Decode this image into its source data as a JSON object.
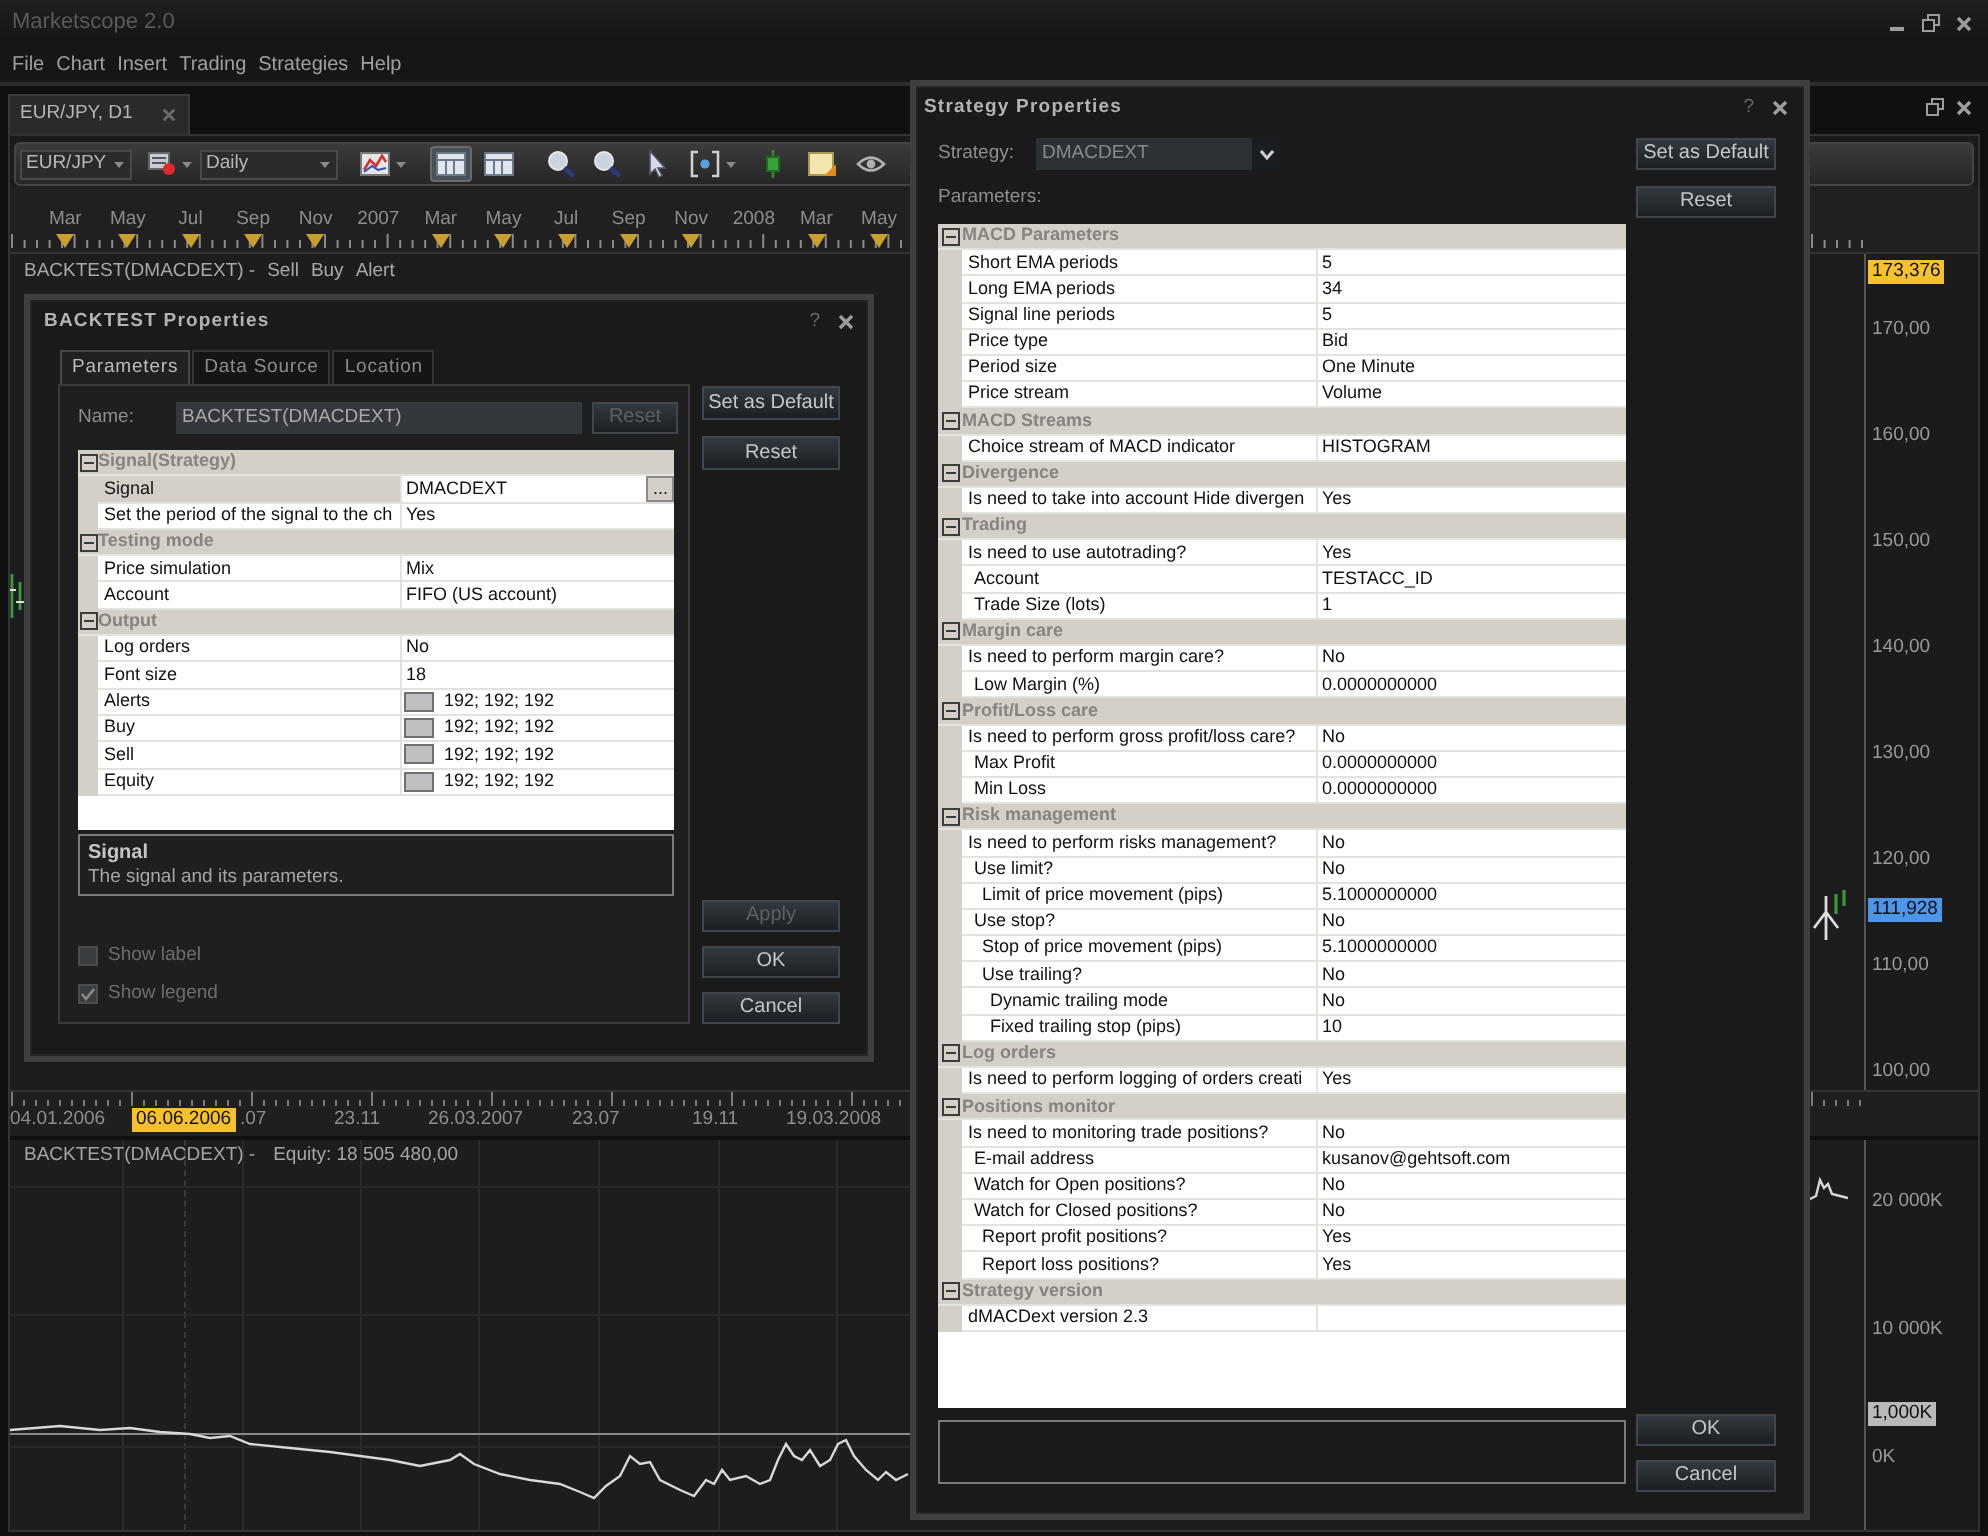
{
  "app": {
    "title": "Marketscope 2.0",
    "menu": [
      "File",
      "Chart",
      "Insert",
      "Trading",
      "Strategies",
      "Help"
    ]
  },
  "chart_window": {
    "tab": {
      "label": "EUR/JPY, D1"
    },
    "toolbar": {
      "instrument": "EUR/JPY",
      "period": "Daily",
      "tools": [
        {
          "kind": "line",
          "pressed": false
        },
        {
          "kind": "table",
          "pressed": true
        },
        {
          "kind": "table",
          "pressed": false
        },
        {
          "kind": "zoom",
          "pressed": false
        },
        {
          "kind": "zoom",
          "pressed": false
        },
        {
          "kind": "pointer",
          "pressed": false
        },
        {
          "kind": "target",
          "pressed": false
        },
        {
          "kind": "candle",
          "pressed": false
        },
        {
          "kind": "note",
          "pressed": false
        },
        {
          "kind": "eye",
          "pressed": false
        }
      ]
    },
    "timeline": [
      {
        "text": "Mar",
        "kind": "month"
      },
      {
        "text": "May",
        "kind": "month"
      },
      {
        "text": "Jul",
        "kind": "month"
      },
      {
        "text": "Sep",
        "kind": "month"
      },
      {
        "text": "Nov",
        "kind": "month"
      },
      {
        "text": "2007",
        "kind": "year"
      },
      {
        "text": "Mar",
        "kind": "month"
      },
      {
        "text": "May",
        "kind": "month"
      },
      {
        "text": "Jul",
        "kind": "month"
      },
      {
        "text": "Sep",
        "kind": "month"
      },
      {
        "text": "Nov",
        "kind": "month"
      },
      {
        "text": "2008",
        "kind": "year"
      },
      {
        "text": "Mar",
        "kind": "month"
      },
      {
        "text": "May",
        "kind": "month"
      }
    ],
    "price_legend": {
      "title": "BACKTEST(DMACDEXT) -",
      "items": [
        "Sell",
        "Buy",
        "Alert"
      ]
    },
    "price_axis": {
      "ticks": [
        "170,00",
        "160,00",
        "150,00",
        "140,00",
        "130,00",
        "120,00",
        "110,00",
        "100,00"
      ],
      "markers": [
        {
          "text": "173,376",
          "color": "#f5c12e"
        },
        {
          "text": "111,928",
          "color": "#4c95e8"
        }
      ]
    },
    "date_axis": [
      {
        "text": "04.01.2006",
        "kind": "tick"
      },
      {
        "text": "06.06.2006",
        "kind": "cursor"
      },
      {
        "text": ".07",
        "kind": "tick"
      },
      {
        "text": "23.11",
        "kind": "tick"
      },
      {
        "text": "26.03.2007",
        "kind": "tick"
      },
      {
        "text": "23.07",
        "kind": "tick"
      },
      {
        "text": "19.11",
        "kind": "tick"
      },
      {
        "text": "19.03.2008",
        "kind": "tick"
      }
    ],
    "equity_panel": {
      "title": "BACKTEST(DMACDEXT) -",
      "value": "Equity: 18 505 480,00",
      "ticks": [
        "20 000K",
        "10 000K",
        "0K"
      ],
      "markers": [
        {
          "text": "1,000K",
          "color": "#b9b9b9"
        }
      ]
    }
  },
  "backtest_dialog": {
    "title": "BACKTEST Properties",
    "help": "?",
    "tabs": [
      {
        "label": "Parameters",
        "selected": true
      },
      {
        "label": "Data Source",
        "selected": false
      },
      {
        "label": "Location",
        "selected": false
      }
    ],
    "name": {
      "label": "Name:",
      "value": "BACKTEST(DMACDEXT)",
      "reset": {
        "label": "Reset",
        "disabled": true
      }
    },
    "grid": [
      {
        "category": "Signal(Strategy)",
        "expanded": true,
        "rows": [
          {
            "name": "Signal",
            "value": "DMACDEXT",
            "kind": "browse",
            "button": "...",
            "selected": true
          },
          {
            "name": "Set the period of the signal to the ch",
            "value": "Yes",
            "kind": "text",
            "selected": false
          }
        ]
      },
      {
        "category": "Testing mode",
        "expanded": true,
        "rows": [
          {
            "name": "Price simulation",
            "value": "Mix",
            "kind": "text",
            "selected": false
          },
          {
            "name": "Account",
            "value": "FIFO (US account)",
            "kind": "text",
            "selected": false
          }
        ]
      },
      {
        "category": "Output",
        "expanded": true,
        "rows": [
          {
            "name": "Log orders",
            "value": "No",
            "kind": "text",
            "selected": false
          },
          {
            "name": "Font size",
            "value": "18",
            "kind": "text",
            "selected": false
          },
          {
            "name": "Alerts",
            "value": "192; 192; 192",
            "kind": "color",
            "color": "#c0c0c0",
            "selected": false
          },
          {
            "name": "Buy",
            "value": "192; 192; 192",
            "kind": "color",
            "color": "#c0c0c0",
            "selected": false
          },
          {
            "name": "Sell",
            "value": "192; 192; 192",
            "kind": "color",
            "color": "#c0c0c0",
            "selected": false
          },
          {
            "name": "Equity",
            "value": "192; 192; 192",
            "kind": "color",
            "color": "#c0c0c0",
            "selected": false
          }
        ]
      }
    ],
    "description": {
      "title": "Signal",
      "text": "The signal and its parameters."
    },
    "checkboxes": [
      {
        "label": "Show label",
        "checked": false
      },
      {
        "label": "Show legend",
        "checked": true
      }
    ],
    "side_buttons": [
      {
        "label": "Set as Default",
        "disabled": false
      },
      {
        "label": "Reset",
        "disabled": false
      }
    ],
    "bottom_buttons": [
      {
        "label": "Apply",
        "disabled": true
      },
      {
        "label": "OK",
        "disabled": false
      },
      {
        "label": "Cancel",
        "disabled": false
      }
    ]
  },
  "strategy_dialog": {
    "title": "Strategy Properties",
    "help": "?",
    "strategy": {
      "label": "Strategy:",
      "value": "DMACDEXT"
    },
    "parameters_label": "Parameters:",
    "grid": [
      {
        "category": "MACD Parameters",
        "expanded": true,
        "rows": [
          {
            "name": "Short EMA periods",
            "value": "5"
          },
          {
            "name": "Long EMA periods",
            "value": "34"
          },
          {
            "name": "Signal line periods",
            "value": "5"
          },
          {
            "name": "Price type",
            "value": "Bid"
          },
          {
            "name": "Period size",
            "value": "One Minute"
          },
          {
            "name": "Price stream",
            "value": "Volume"
          }
        ]
      },
      {
        "category": "MACD Streams",
        "expanded": true,
        "rows": [
          {
            "name": "Choice stream of MACD indicator",
            "value": "HISTOGRAM"
          }
        ]
      },
      {
        "category": "Divergence",
        "expanded": true,
        "rows": [
          {
            "name": "Is need to take into account Hide divergen",
            "value": "Yes"
          }
        ]
      },
      {
        "category": "Trading",
        "expanded": true,
        "rows": [
          {
            "name": "Is need to use autotrading?",
            "value": "Yes",
            "children": [
              {
                "name": "Account",
                "value": "TESTACC_ID"
              },
              {
                "name": "Trade Size (lots)",
                "value": "1"
              }
            ]
          }
        ]
      },
      {
        "category": "Margin care",
        "expanded": true,
        "rows": [
          {
            "name": "Is need to perform margin care?",
            "value": "No",
            "children": [
              {
                "name": "Low Margin (%)",
                "value": "0.0000000000"
              }
            ]
          }
        ]
      },
      {
        "category": "Profit/Loss care",
        "expanded": true,
        "rows": [
          {
            "name": "Is need to perform gross profit/loss care?",
            "value": "No",
            "children": [
              {
                "name": "Max Profit",
                "value": "0.0000000000"
              },
              {
                "name": "Min Loss",
                "value": "0.0000000000"
              }
            ]
          }
        ]
      },
      {
        "category": "Risk management",
        "expanded": true,
        "rows": [
          {
            "name": "Is need to perform risks management?",
            "value": "No",
            "children": [
              {
                "name": "Use limit?",
                "value": "No",
                "children": [
                  {
                    "name": "Limit of price movement (pips)",
                    "value": "5.1000000000"
                  }
                ]
              },
              {
                "name": "Use stop?",
                "value": "No",
                "children": [
                  {
                    "name": "Stop of price movement (pips)",
                    "value": "5.1000000000"
                  },
                  {
                    "name": "Use trailing?",
                    "value": "No",
                    "children": [
                      {
                        "name": "Dynamic trailing mode",
                        "value": "No"
                      },
                      {
                        "name": "Fixed trailing stop (pips)",
                        "value": "10"
                      }
                    ]
                  }
                ]
              }
            ]
          }
        ]
      },
      {
        "category": "Log orders",
        "expanded": true,
        "rows": [
          {
            "name": "Is need to perform logging of orders creati",
            "value": "Yes"
          }
        ]
      },
      {
        "category": "Positions monitor",
        "expanded": true,
        "rows": [
          {
            "name": "Is need to monitoring trade positions?",
            "value": "No",
            "children": [
              {
                "name": "E-mail address",
                "value": "kusanov@gehtsoft.com"
              },
              {
                "name": "Watch for Open positions?",
                "value": "No"
              },
              {
                "name": "Watch for Closed positions?",
                "value": "No",
                "children": [
                  {
                    "name": "Report profit positions?",
                    "value": "Yes"
                  },
                  {
                    "name": "Report loss positions?",
                    "value": "Yes"
                  }
                ]
              }
            ]
          }
        ]
      },
      {
        "category": "Strategy version",
        "expanded": true,
        "rows": [
          {
            "name": "dMACDext version 2.3"
          }
        ]
      }
    ],
    "side_buttons": [
      {
        "label": "Set as Default"
      },
      {
        "label": "Reset"
      }
    ],
    "bottom_buttons": [
      {
        "label": "OK"
      },
      {
        "label": "Cancel"
      }
    ]
  }
}
